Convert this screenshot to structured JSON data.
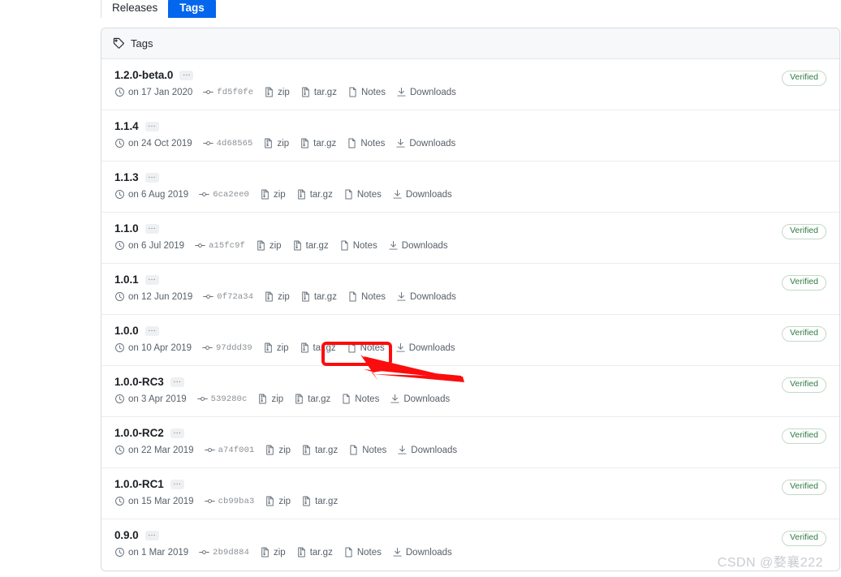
{
  "tabs": [
    {
      "label": "Releases",
      "active": false
    },
    {
      "label": "Tags",
      "active": true
    }
  ],
  "panel": {
    "header_label": "Tags",
    "header_icon": "tag-icon"
  },
  "labels": {
    "ellipsis": "…",
    "zip": "zip",
    "targz": "tar.gz",
    "notes": "Notes",
    "downloads": "Downloads",
    "verified": "Verified"
  },
  "colors": {
    "tab_active_bg": "#0366ec",
    "annotation_red": "#fb0d0d",
    "verified_text": "#2f7b45",
    "verified_border": "#c3d9c8",
    "panel_header_bg": "#f7f8fa",
    "meta_text": "#586069"
  },
  "tags": [
    {
      "name": "1.2.0-beta.0",
      "date": "on 17 Jan 2020",
      "sha": "fd5f0fe",
      "has_notes": true,
      "has_downloads": true,
      "verified": true
    },
    {
      "name": "1.1.4",
      "date": "on 24 Oct 2019",
      "sha": "4d68565",
      "has_notes": true,
      "has_downloads": true,
      "verified": false
    },
    {
      "name": "1.1.3",
      "date": "on 6 Aug 2019",
      "sha": "6ca2ee0",
      "has_notes": true,
      "has_downloads": true,
      "verified": false
    },
    {
      "name": "1.1.0",
      "date": "on 6 Jul 2019",
      "sha": "a15fc9f",
      "has_notes": true,
      "has_downloads": true,
      "verified": true
    },
    {
      "name": "1.0.1",
      "date": "on 12 Jun 2019",
      "sha": "0f72a34",
      "has_notes": true,
      "has_downloads": true,
      "verified": true
    },
    {
      "name": "1.0.0",
      "date": "on 10 Apr 2019",
      "sha": "97ddd39",
      "has_notes": true,
      "has_downloads": true,
      "verified": true
    },
    {
      "name": "1.0.0-RC3",
      "date": "on 3 Apr 2019",
      "sha": "539280c",
      "has_notes": true,
      "has_downloads": true,
      "verified": true
    },
    {
      "name": "1.0.0-RC2",
      "date": "on 22 Mar 2019",
      "sha": "a74f001",
      "has_notes": true,
      "has_downloads": true,
      "verified": true
    },
    {
      "name": "1.0.0-RC1",
      "date": "on 15 Mar 2019",
      "sha": "cb99ba3",
      "has_notes": false,
      "has_downloads": false,
      "verified": true
    },
    {
      "name": "0.9.0",
      "date": "on 1 Mar 2019",
      "sha": "2b9d884",
      "has_notes": true,
      "has_downloads": true,
      "verified": true
    }
  ],
  "annotation": {
    "target_row_index": 5,
    "target_label": "Downloads",
    "shape": "rectangle-with-arrow"
  },
  "watermark": {
    "text": "CSDN @婺襄222"
  }
}
